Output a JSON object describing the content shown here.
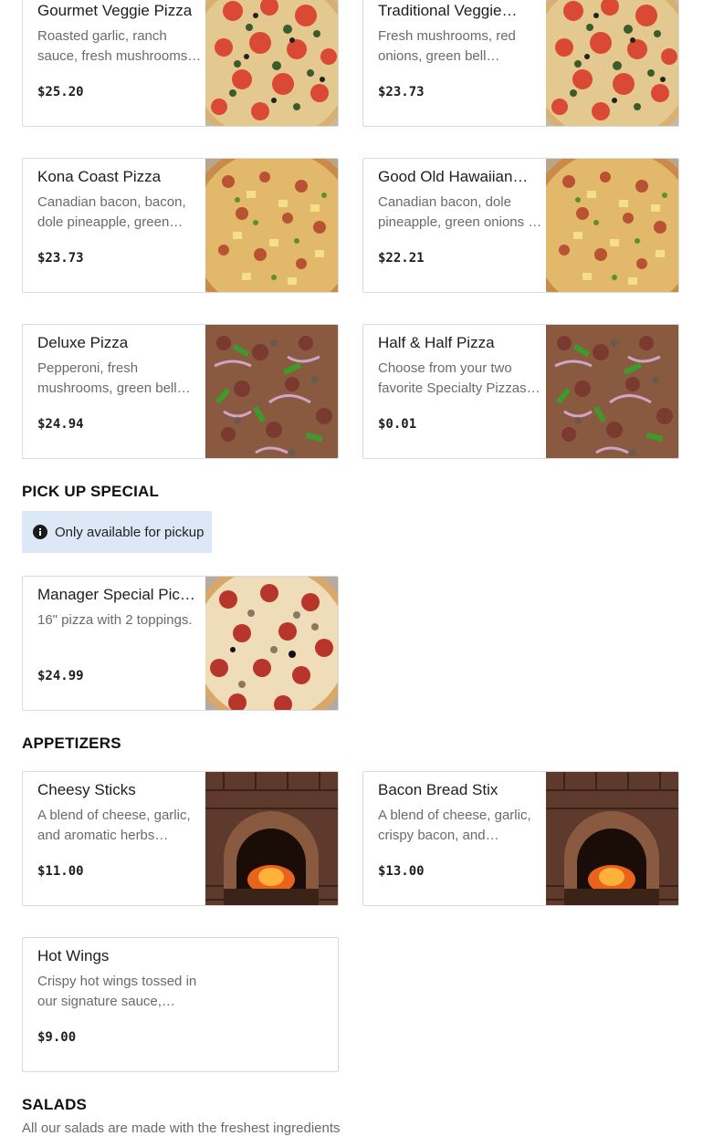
{
  "items": {
    "gourmet_veggie": {
      "name": "Gourmet Veggie Pizza",
      "desc": "Roasted garlic, ranch sauce, fresh mushrooms…",
      "price": "$25.20",
      "image": "veggie-pizza"
    },
    "traditional_veggie": {
      "name": "Traditional Veggie…",
      "desc": "Fresh mushrooms, red onions, green bell pepper…",
      "price": "$23.73",
      "image": "veggie-pizza"
    },
    "kona_coast": {
      "name": "Kona Coast Pizza",
      "desc": "Canadian bacon, bacon, dole pineapple, green…",
      "price": "$23.73",
      "image": "hawaiian-pizza"
    },
    "good_old_hawaiian": {
      "name": "Good Old Hawaiian…",
      "desc": "Canadian bacon, dole pineapple, green onions …",
      "price": "$22.21",
      "image": "hawaiian-pizza"
    },
    "deluxe": {
      "name": "Deluxe Pizza",
      "desc": "Pepperoni, fresh mushrooms, green bell…",
      "price": "$24.94",
      "image": "deluxe-pizza"
    },
    "half_half": {
      "name": "Half & Half Pizza",
      "desc": "Choose from your two favorite Specialty Pizzas…",
      "price": "$0.01",
      "image": "deluxe-pizza"
    },
    "manager_special": {
      "name": "Manager Special Pic…",
      "desc": "16\" pizza with 2 toppings.",
      "price": "$24.99",
      "image": "pepperoni-pizza"
    },
    "cheesy_sticks": {
      "name": "Cheesy Sticks",
      "desc": "A blend of cheese, garlic, and aromatic herbs bake…",
      "price": "$11.00",
      "image": "brick-oven"
    },
    "bacon_bread_stix": {
      "name": "Bacon Bread Stix",
      "desc": "A blend of cheese, garlic, crispy bacon, and…",
      "price": "$13.00",
      "image": "brick-oven"
    },
    "hot_wings": {
      "name": "Hot Wings",
      "desc": "Crispy hot wings tossed in our signature sauce,…",
      "price": "$9.00"
    }
  },
  "sections": {
    "pickup_special": {
      "title": "PICK UP SPECIAL",
      "notice": "Only available for pickup",
      "notice_icon": "info-icon"
    },
    "appetizers": {
      "title": "APPETIZERS"
    },
    "salads": {
      "title": "SALADS",
      "desc": "All our salads are made with the freshest ingredients"
    }
  },
  "colors": {
    "notice_bg": "#dde8f6",
    "border": "#d9d9d9",
    "text": "#1e1e1e",
    "muted": "#6a6a6a"
  }
}
